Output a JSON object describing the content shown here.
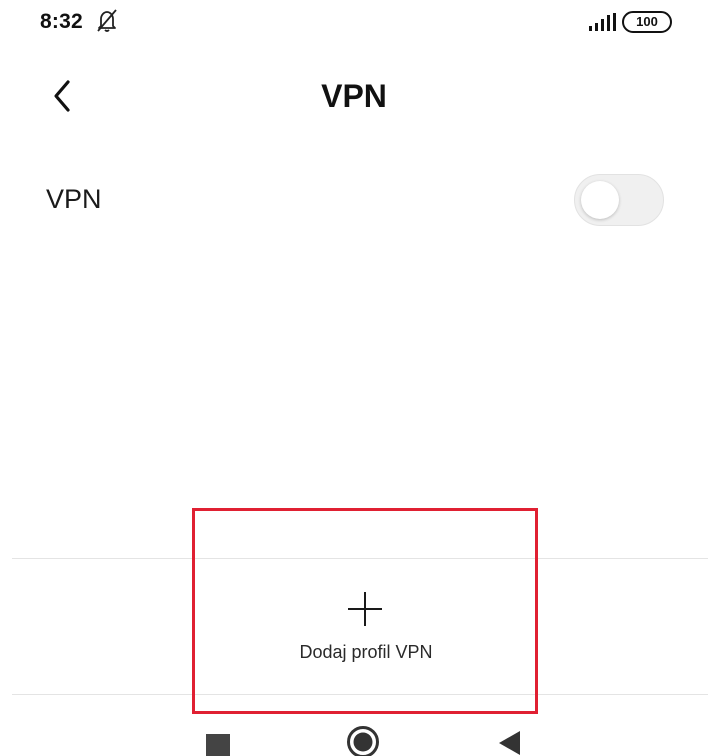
{
  "status_bar": {
    "time": "8:32",
    "battery": "100",
    "icons": [
      "bell-off-icon",
      "signal-icon",
      "battery-icon"
    ]
  },
  "header": {
    "title": "VPN",
    "back_icon": "back-icon"
  },
  "vpn_row": {
    "label": "VPN",
    "toggle_enabled": false
  },
  "add_profile": {
    "icon": "plus-icon",
    "label": "Dodaj profil VPN"
  },
  "nav_bar": {
    "icons": [
      "nav-recents-icon",
      "nav-home-icon",
      "nav-back-icon"
    ]
  },
  "colors": {
    "highlight": "#e02032",
    "toggle_off": "#f0f0f0"
  }
}
